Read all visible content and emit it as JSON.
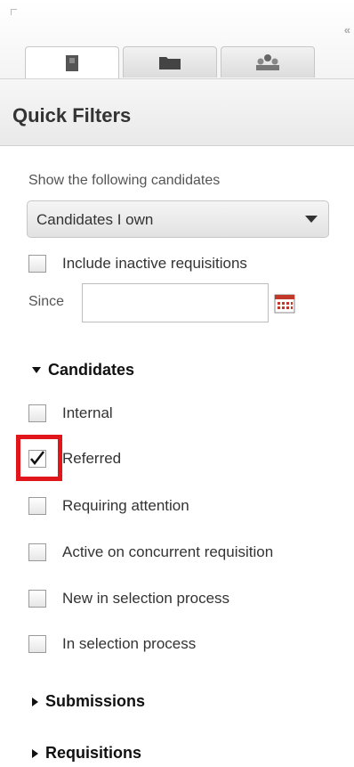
{
  "panel": {
    "collapse_glyph": "«",
    "tabs": [
      {
        "icon": "person-icon",
        "active": true
      },
      {
        "icon": "folder-icon",
        "active": false
      },
      {
        "icon": "group-icon",
        "active": false
      }
    ]
  },
  "quick_filters": {
    "title": "Quick Filters",
    "show_label": "Show the following candidates",
    "dropdown_value": "Candidates I own",
    "include_inactive_label": "Include inactive requisitions",
    "include_inactive_checked": false,
    "since_label": "Since",
    "since_value": ""
  },
  "candidates_section": {
    "title": "Candidates",
    "expanded": true,
    "items": [
      {
        "label": "Internal",
        "checked": false
      },
      {
        "label": "Referred",
        "checked": true
      },
      {
        "label": "Requiring attention",
        "checked": false
      },
      {
        "label": "Active on concurrent requisition",
        "checked": false
      },
      {
        "label": "New in selection process",
        "checked": false
      },
      {
        "label": "In selection process",
        "checked": false
      }
    ]
  },
  "submissions_section": {
    "title": "Submissions",
    "expanded": false
  },
  "requisitions_section": {
    "title": "Requisitions",
    "expanded": false
  },
  "colors": {
    "highlight": "#e0161b"
  }
}
